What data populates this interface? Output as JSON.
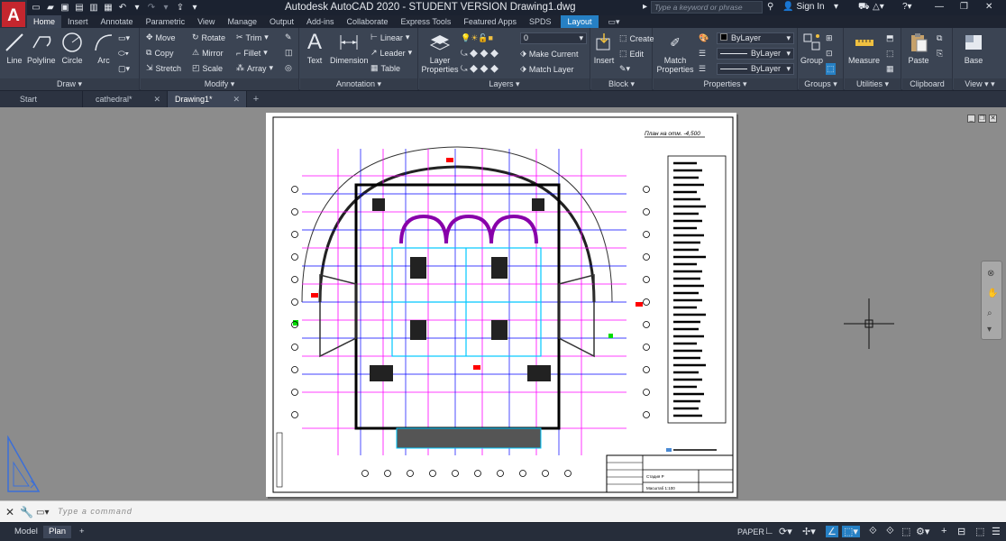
{
  "app": {
    "title": "Autodesk AutoCAD 2020 - STUDENT VERSION    Drawing1.dwg",
    "logo_letter": "A",
    "search_placeholder": "Type a keyword or phrase",
    "signin_label": "Sign In"
  },
  "tabs": [
    {
      "label": "Home",
      "active": true
    },
    {
      "label": "Insert"
    },
    {
      "label": "Annotate"
    },
    {
      "label": "Parametric"
    },
    {
      "label": "View"
    },
    {
      "label": "Manage"
    },
    {
      "label": "Output"
    },
    {
      "label": "Add-ins"
    },
    {
      "label": "Collaborate"
    },
    {
      "label": "Express Tools"
    },
    {
      "label": "Featured Apps"
    },
    {
      "label": "SPDS"
    },
    {
      "label": "Layout",
      "highlight": true
    }
  ],
  "ribbon": {
    "draw": {
      "panel_label": "Draw",
      "line": "Line",
      "polyline": "Polyline",
      "circle": "Circle",
      "arc": "Arc"
    },
    "modify": {
      "panel_label": "Modify",
      "move": "Move",
      "rotate": "Rotate",
      "trim": "Trim",
      "copy": "Copy",
      "mirror": "Mirror",
      "fillet": "Fillet",
      "stretch": "Stretch",
      "scale": "Scale",
      "array": "Array"
    },
    "annotation": {
      "panel_label": "Annotation",
      "text": "Text",
      "dimension": "Dimension",
      "linear": "Linear",
      "leader": "Leader",
      "table": "Table"
    },
    "layers": {
      "panel_label": "Layers",
      "layer_properties": "Layer Properties",
      "current_layer": "0",
      "make_current": "Make Current",
      "match_layer": "Match Layer"
    },
    "block": {
      "panel_label": "Block",
      "insert": "Insert",
      "create": "Create",
      "edit": "Edit"
    },
    "properties": {
      "panel_label": "Properties",
      "match_properties": "Match Properties",
      "color": "ByLayer",
      "lineweight": "ByLayer",
      "linetype": "ByLayer"
    },
    "groups": {
      "panel_label": "Groups",
      "group": "Group"
    },
    "utilities": {
      "panel_label": "Utilities",
      "measure": "Measure"
    },
    "clipboard": {
      "panel_label": "Clipboard",
      "paste": "Paste"
    },
    "view": {
      "panel_label": "View",
      "base": "Base"
    }
  },
  "doc_tabs": [
    {
      "label": "Start"
    },
    {
      "label": "cathedral*"
    },
    {
      "label": "Drawing1*",
      "active": true
    }
  ],
  "drawing": {
    "sheet_title": "План на отм. -4,500",
    "stamp_line1": "Стадия Р",
    "stamp_line2": "Масштаб 1:100"
  },
  "command": {
    "placeholder": "Type a command"
  },
  "status": {
    "layout_tabs": [
      {
        "label": "Model"
      },
      {
        "label": "Plan",
        "active": true
      }
    ],
    "space": "PAPER"
  },
  "colors": {
    "accent": "#2680c4",
    "ribbon_bg": "#3b4453",
    "title_bg": "#1b2230",
    "canvas_bg": "#8c8c8c"
  }
}
